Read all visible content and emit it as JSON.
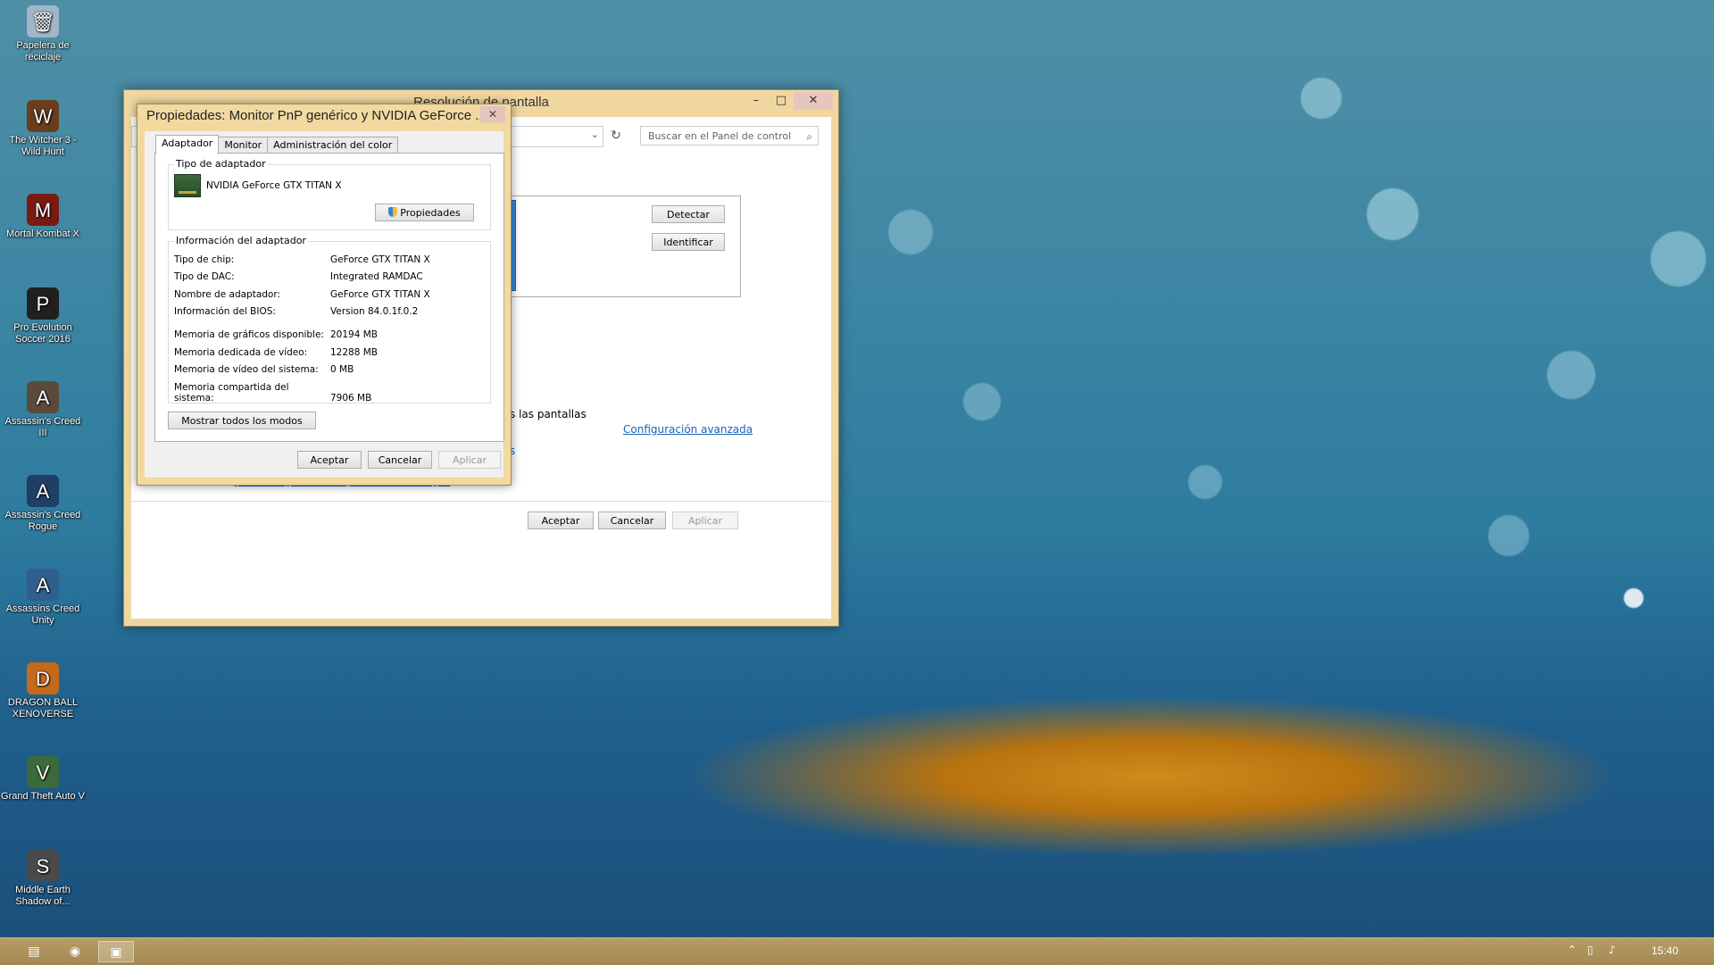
{
  "desktop": {
    "icons": [
      {
        "label": "Papelera de reciclaje",
        "icon": "recycle-bin-icon",
        "glyph": "🗑",
        "color": "#9fb7c9"
      },
      {
        "label": "The Witcher 3 - Wild Hunt",
        "icon": "witcher-icon",
        "glyph": "W",
        "color": "#6a3d1c"
      },
      {
        "label": "Mortal Kombat X",
        "icon": "mortal-kombat-icon",
        "glyph": "M",
        "color": "#7a1a12"
      },
      {
        "label": "Pro Evolution Soccer 2016",
        "icon": "pes-icon",
        "glyph": "P",
        "color": "#202020"
      },
      {
        "label": "Assassin's Creed III",
        "icon": "assassins-creed-iii-icon",
        "glyph": "A",
        "color": "#5b4a3a"
      },
      {
        "label": "Assassin's Creed Rogue",
        "icon": "assassins-creed-rogue-icon",
        "glyph": "A",
        "color": "#1f3f66"
      },
      {
        "label": "Assassins Creed Unity",
        "icon": "assassins-creed-unity-icon",
        "glyph": "A",
        "color": "#2f5f8f"
      },
      {
        "label": "DRAGON BALL XENOVERSE",
        "icon": "dragon-ball-icon",
        "glyph": "D",
        "color": "#c46a1a"
      },
      {
        "label": "Grand Theft Auto V",
        "icon": "gta-icon",
        "glyph": "V",
        "color": "#3b6a3b"
      },
      {
        "label": "Middle Earth Shadow of...",
        "icon": "middle-earth-icon",
        "glyph": "S",
        "color": "#4a4a4a"
      }
    ]
  },
  "main_window": {
    "title": "Resolución de pantalla",
    "search_placeholder": "Buscar en el Panel de control",
    "detect_label": "Detectar",
    "identify_label": "Identificar",
    "all_screens_text": "s las pantallas",
    "advanced_link": "Configuración avanzada",
    "partial_link": "s",
    "help_link": "¿Qué configuración de pantalla debo elegir?",
    "ok_label": "Aceptar",
    "cancel_label": "Cancelar",
    "apply_label": "Aplicar"
  },
  "dialog": {
    "title": "Propiedades: Monitor PnP genérico y NVIDIA GeForce ...",
    "tabs": [
      "Adaptador",
      "Monitor",
      "Administración del color"
    ],
    "adapter_type_group": "Tipo de adaptador",
    "adapter_name": "NVIDIA GeForce GTX TITAN X",
    "properties_label": "Propiedades",
    "adapter_info_group": "Información del adaptador",
    "info_rows": [
      {
        "key": "Tipo de chip:",
        "value": "GeForce GTX TITAN X"
      },
      {
        "key": "Tipo de DAC:",
        "value": "Integrated RAMDAC"
      },
      {
        "key": "Nombre de adaptador:",
        "value": "GeForce GTX TITAN X"
      },
      {
        "key": "Información del BIOS:",
        "value": "Version 84.0.1f.0.2"
      }
    ],
    "memory_rows": [
      {
        "key": "Memoria de gráficos disponible:",
        "value": "20194 MB"
      },
      {
        "key": "Memoria dedicada de vídeo:",
        "value": "12288 MB"
      },
      {
        "key": "Memoria de vídeo del sistema:",
        "value": "0 MB"
      },
      {
        "key": "Memoria compartida del sistema:",
        "value": "7906 MB"
      }
    ],
    "show_modes_label": "Mostrar todos los modos",
    "ok_label": "Aceptar",
    "cancel_label": "Cancelar",
    "apply_label": "Aplicar"
  },
  "taskbar": {
    "clock": "15:40",
    "items": [
      "file-explorer-icon",
      "chrome-icon",
      "control-panel-icon"
    ]
  }
}
